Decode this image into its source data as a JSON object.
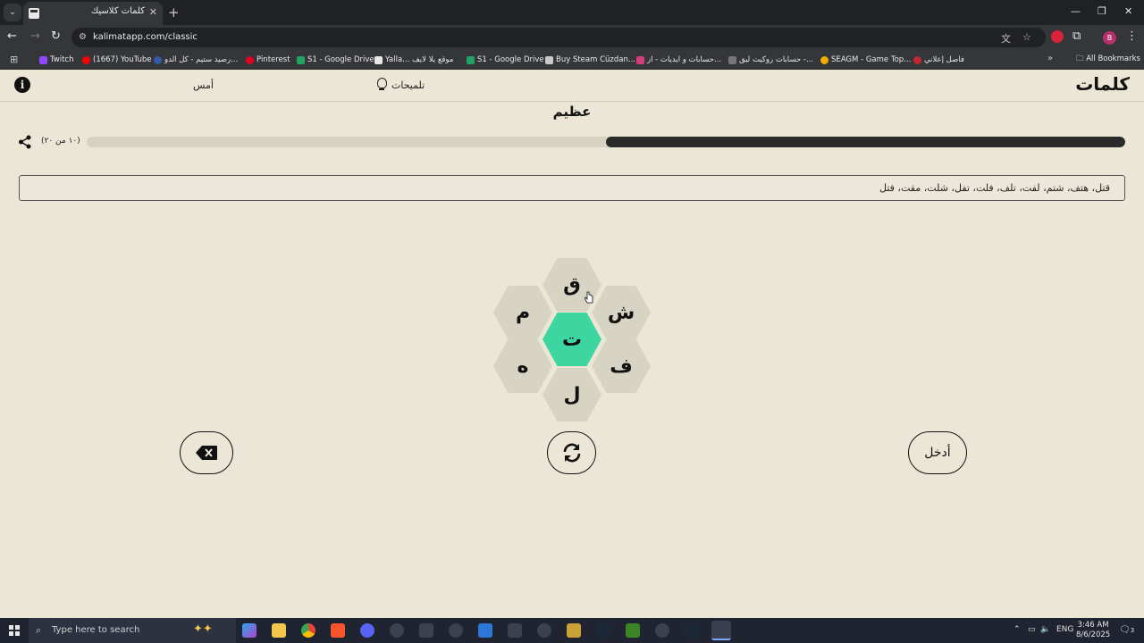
{
  "browser": {
    "tab_title": "كلمات كلاسيك",
    "url": "kalimatapp.com/classic",
    "profile_initial": "B",
    "bookmarks": [
      {
        "label": "Twitch",
        "color": "#9146ff"
      },
      {
        "label": "(1667) YouTube",
        "color": "#ff0000"
      },
      {
        "label": "رصيد ستيم - كل الدو...",
        "color": "#3558a8"
      },
      {
        "label": "Pinterest",
        "color": "#e60023"
      },
      {
        "label": "S1 - Google Drive",
        "color": "#1fa463"
      },
      {
        "label": "Yalla... موقع يلا لايف",
        "color": "#e8e8e8"
      },
      {
        "label": "S1 - Google Drive",
        "color": "#1fa463"
      },
      {
        "label": "Buy Steam Cüzdan...",
        "color": "#c8c8c8"
      },
      {
        "label": "حسابات و ايديات - از...",
        "color": "#d63c7a"
      },
      {
        "label": "حسابات روكيت ليق -...",
        "color": "#777777"
      },
      {
        "label": "SEAGM - Game Top...",
        "color": "#f2a900"
      },
      {
        "label": "فاصل إعلاني",
        "color": "#c4272f"
      }
    ],
    "all_bookmarks_label": "All Bookmarks"
  },
  "game": {
    "logo": "كلمات",
    "hints_label": "تلميحات",
    "yesterday_label": "أمس",
    "rank": "عظيم",
    "progress_count": "(١٠ من ٢٠)",
    "progress_fraction": 0.5,
    "found_words": "قتل، هتف، شتم، لفت، تلف، فلت، تفل، شلت، مقت، فتل",
    "letters": {
      "top": "ق",
      "upper_left": "م",
      "upper_right": "ش",
      "center": "ت",
      "lower_left": "ه",
      "lower_right": "ف",
      "bottom": "ل"
    },
    "enter_label": "أدخل",
    "colors": {
      "center": "#3dd5a0",
      "outer": "#d8d4c4",
      "background": "#ebe6d6"
    }
  },
  "taskbar": {
    "search_placeholder": "Type here to search",
    "language": "ENG",
    "time": "3:46 AM",
    "date": "8/6/2025",
    "notification_count": "3"
  }
}
